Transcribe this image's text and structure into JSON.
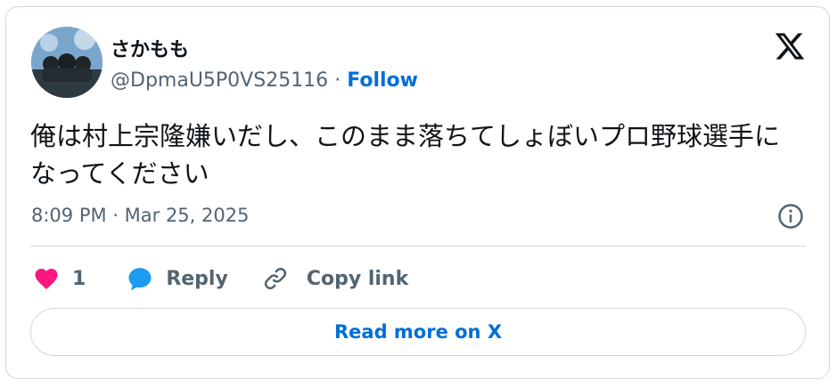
{
  "author": {
    "name": "さかもも",
    "handle": "@DpmaU5P0VS25116",
    "separator": "·",
    "follow_label": "Follow"
  },
  "tweet": {
    "text": "俺は村上宗隆嫌いだし、このまま落ちてしょぼいプロ野球選手になってください",
    "timestamp": "8:09 PM · Mar 25, 2025"
  },
  "actions": {
    "like_count": "1",
    "reply_label": "Reply",
    "copy_link_label": "Copy link"
  },
  "read_more_label": "Read more on X",
  "colors": {
    "accent": "#006fd6",
    "like": "#f91880",
    "reply": "#1d9bf0",
    "muted": "#536471",
    "border": "#cfd9de"
  },
  "icons": {
    "platform": "x-logo-icon",
    "info": "info-icon",
    "like": "heart-icon",
    "reply": "speech-bubble-icon",
    "copy_link": "link-icon"
  }
}
